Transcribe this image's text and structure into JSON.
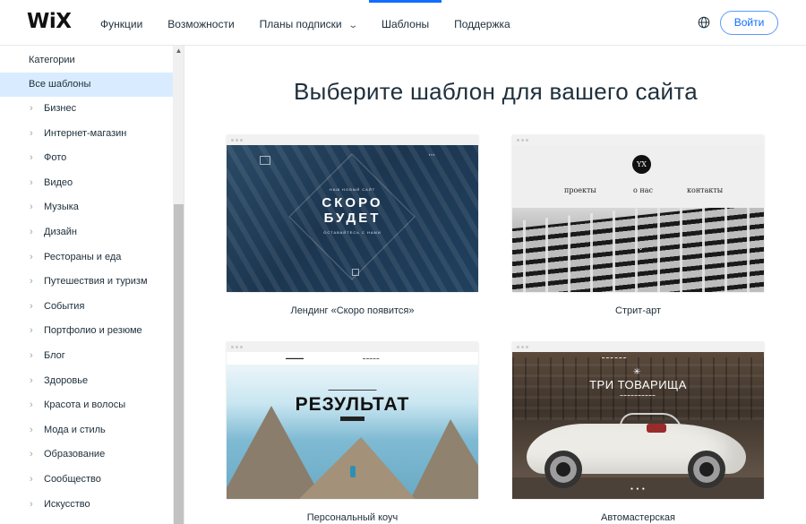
{
  "header": {
    "logo": "WiX",
    "nav": [
      {
        "label": "Функции",
        "active": false,
        "has_dropdown": false
      },
      {
        "label": "Возможности",
        "active": false,
        "has_dropdown": false
      },
      {
        "label": "Планы подписки",
        "active": false,
        "has_dropdown": true
      },
      {
        "label": "Шаблоны",
        "active": true,
        "has_dropdown": false
      },
      {
        "label": "Поддержка",
        "active": false,
        "has_dropdown": false
      }
    ],
    "globe_icon": "globe-icon",
    "login_label": "Войти",
    "accent_color": "#116dff"
  },
  "sidebar": {
    "title": "Категории",
    "all_label": "Все шаблоны",
    "items": [
      "Бизнес",
      "Интернет-магазин",
      "Фото",
      "Видео",
      "Музыка",
      "Дизайн",
      "Рестораны и еда",
      "Путешествия и туризм",
      "События",
      "Портфолио и резюме",
      "Блог",
      "Здоровье",
      "Красота и волосы",
      "Мода и стиль",
      "Образование",
      "Сообщество",
      "Искусство"
    ],
    "selected_bg": "#d9ecff"
  },
  "main": {
    "title": "Выберите шаблон для вашего сайта",
    "templates": [
      {
        "label": "Лендинг «Скоро появится»",
        "thumb": {
          "site_tag": "НАШ НОВЫЙ САЙТ",
          "headline_1": "СКОРО",
          "headline_2": "БУДЕТ",
          "subline": "ОСТАВАЙТЕСЬ С НАМИ"
        }
      },
      {
        "label": "Стрит-арт",
        "thumb": {
          "logo": "YX",
          "links": [
            "проекты",
            "о нас",
            "контакты"
          ]
        }
      },
      {
        "label": "Персональный коуч",
        "thumb": {
          "headline": "РЕЗУЛЬТАТ"
        }
      },
      {
        "label": "Автомастерская",
        "thumb": {
          "headline": "ТРИ ТОВАРИЩА"
        }
      }
    ]
  }
}
